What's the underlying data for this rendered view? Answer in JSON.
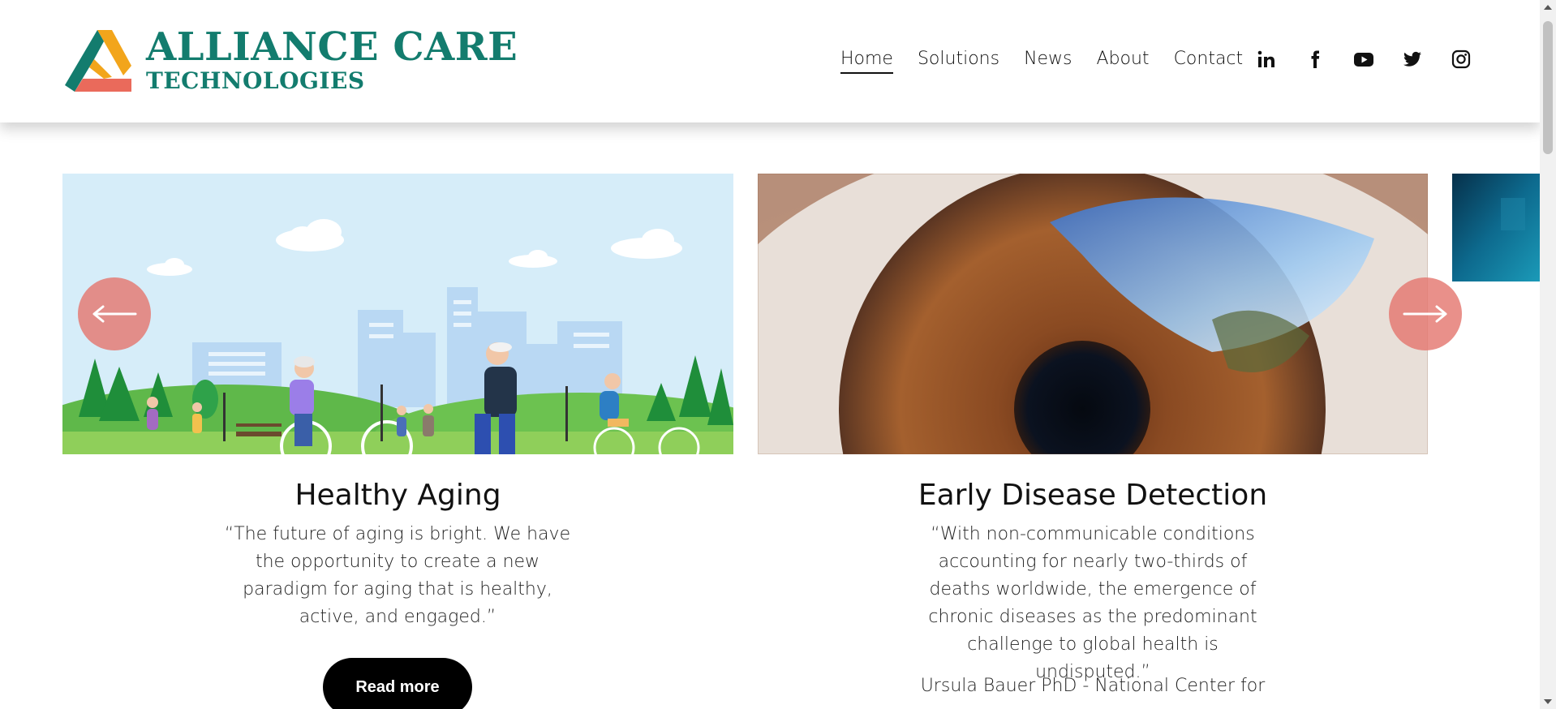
{
  "brand": {
    "line1": "ALLIANCE CARE",
    "line2": "TECHNOLOGIES",
    "colors": {
      "teal": "#137c6e",
      "orange": "#f2a51b",
      "coral": "#ea6a5b"
    }
  },
  "nav": {
    "items": [
      {
        "label": "Home",
        "active": true
      },
      {
        "label": "Solutions",
        "active": false
      },
      {
        "label": "News",
        "active": false
      },
      {
        "label": "About",
        "active": false
      },
      {
        "label": "Contact",
        "active": false
      }
    ]
  },
  "social": [
    "linkedin-icon",
    "facebook-icon",
    "youtube-icon",
    "twitter-icon",
    "instagram-icon"
  ],
  "carousel": {
    "prev_icon": "arrow-left-icon",
    "next_icon": "arrow-right-icon",
    "slides": [
      {
        "title": "Healthy Aging",
        "quote": "“The future of aging is bright. We have the opportunity to create a new paradigm for aging that is healthy, active, and engaged.”",
        "button": "Read more",
        "image": "seniors-in-park-illustration"
      },
      {
        "title": "Early Disease Detection",
        "quote": "“With non-communicable conditions accounting for nearly two-thirds of deaths worldwide, the emergence of chronic diseases as the predominant challenge to global health is undisputed.”",
        "author": "Ursula Bauer PhD - National Center for",
        "image": "eye-iris-closeup-photo"
      },
      {
        "image": "blue-abstract-photo"
      }
    ]
  }
}
